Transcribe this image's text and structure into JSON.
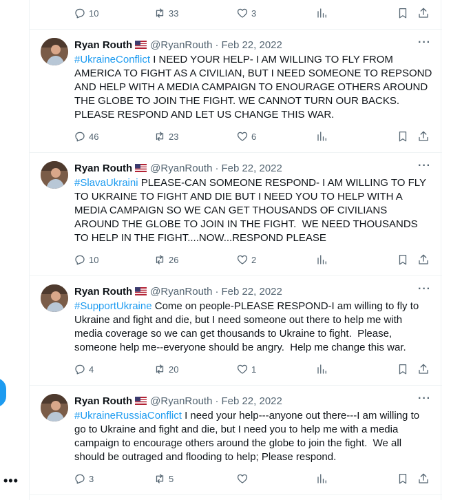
{
  "top_actions": {
    "replies": "10",
    "retweets": "33",
    "likes": "3"
  },
  "tweets": [
    {
      "name": "Ryan Routh",
      "handle": "@RyanRouth",
      "separator": "·",
      "date": "Feb 22, 2022",
      "hashtag": "#UkraineConflict",
      "text": " I NEED YOUR HELP- I AM WILLING TO FLY FROM AMERICA TO FIGHT AS A CIVILIAN, BUT I NEED SOMEONE TO REPSOND AND HELP WITH A MEDIA CAMPAIGN TO ENOURAGE OTHERS AROUND THE GLOBE TO JOIN THE FIGHT. WE CANNOT TURN OUR BACKS.  PLEASE RESPOND AND LET US CHANGE THIS WAR.",
      "replies": "46",
      "retweets": "23",
      "likes": "6"
    },
    {
      "name": "Ryan Routh",
      "handle": "@RyanRouth",
      "separator": "·",
      "date": "Feb 22, 2022",
      "hashtag": "#SlavaUkraini",
      "text": " PLEASE-CAN SOMEONE RESPOND- I AM WILLING TO FLY TO UKRAINE TO FIGHT AND DIE BUT I NEED YOU TO HELP WITH A MEDIA CAMPAIGN SO WE CAN GET THOUSANDS OF CIVILIANS AROUND THE GLOBE TO JOIN IN THE FIGHT.  WE NEED THOUSANDS TO HELP IN THE FIGHT....NOW...RESPOND PLEASE",
      "replies": "10",
      "retweets": "26",
      "likes": "2"
    },
    {
      "name": "Ryan Routh",
      "handle": "@RyanRouth",
      "separator": "·",
      "date": "Feb 22, 2022",
      "hashtag": "#SupportUkraine",
      "text": " Come on people-PLEASE RESPOND-I am willing to fly to Ukraine and fight and die, but I need someone out there to help me with media coverage so we can get thousands to Ukraine to fight.  Please, someone help me--everyone should be angry.  Help me change this war.",
      "replies": "4",
      "retweets": "20",
      "likes": "1"
    },
    {
      "name": "Ryan Routh",
      "handle": "@RyanRouth",
      "separator": "·",
      "date": "Feb 22, 2022",
      "hashtag": "#UkraineRussiaConflict",
      "text": " I need your help---anyone out there---I am willing to go to Ukraine and fight and die, but I need you to help me with a media campaign to encourage others around the globe to join the fight.  We all should be outraged and flooding to help; Please respond.",
      "replies": "3",
      "retweets": "5",
      "likes": ""
    }
  ],
  "icons": {
    "reply": "reply-icon",
    "retweet": "retweet-icon",
    "like": "heart-icon",
    "views": "views-icon",
    "bookmark": "bookmark-icon",
    "share": "share-icon",
    "more": "more-icon",
    "flag": "us-flag-icon"
  },
  "colors": {
    "accent": "#1d9bf0",
    "secondary_text": "#536471",
    "divider": "#eff3f4"
  }
}
